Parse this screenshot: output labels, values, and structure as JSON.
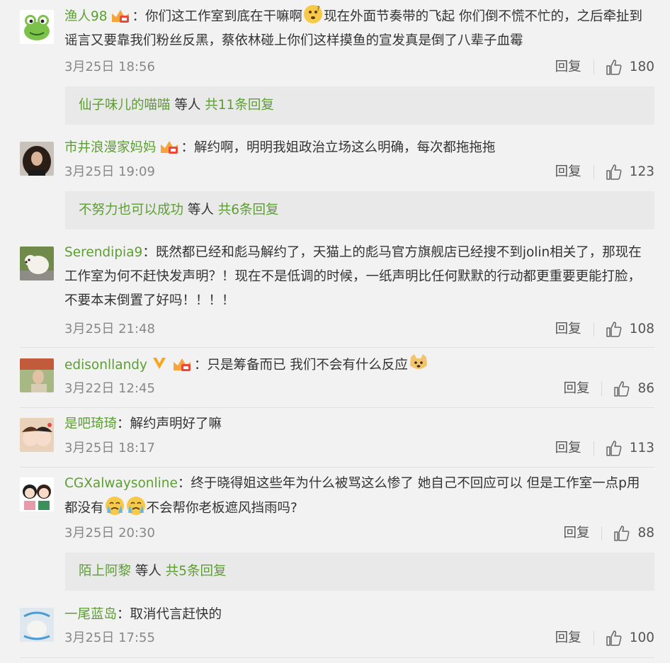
{
  "reply_label": "回复",
  "comments": [
    {
      "user": "渔人98",
      "text": "：你们这工作室到底在干嘛啊",
      "text2": "现在外面节奏带的飞起 你们倒不慌不忙的，之后牵扯到谣言又要靠我们粉丝反黑，蔡依林碰上你们这样摸鱼的宣发真是倒了八辈子血霉",
      "time": "3月25日 18:56",
      "likes": "180",
      "replies": {
        "names": "仙子味儿的喵喵",
        "mid": " 等人 ",
        "count": "共11条回复"
      }
    },
    {
      "user": "市井浪漫家妈妈",
      "text": "：解约啊，明明我姐政治立场这么明确，每次都拖拖拖",
      "time": "3月25日 19:09",
      "likes": "123",
      "replies": {
        "names": "不努力也可以成功",
        "mid": " 等人 ",
        "count": "共6条回复"
      }
    },
    {
      "user": "Serendipia9",
      "text": "：既然都已经和彪马解约了，天猫上的彪马官方旗舰店已经搜不到jolin相关了，那现在工作室为何不赶快发声明？！现在不是低调的时候，一纸声明比任何默默的行动都更重要更能打脸，不要本末倒置了好吗！！！！",
      "time": "3月25日 21:48",
      "likes": "108"
    },
    {
      "user": "edisonllandy",
      "text": "：只是筹备而已 我们不会有什么反应",
      "time": "3月22日 12:45",
      "likes": "86"
    },
    {
      "user": "是吧琦琦",
      "text": "：解约声明好了嘛",
      "time": "3月25日 18:17",
      "likes": "113"
    },
    {
      "user": "CGXalwaysonline",
      "text": "：终于晓得姐这些年为什么被骂这么惨了 她自己不回应可以 但是工作室一点p用都没有",
      "text2": "不会帮你老板遮风挡雨吗?",
      "time": "3月25日 20:30",
      "likes": "88",
      "replies": {
        "names": "陌上阿黎",
        "mid": " 等人 ",
        "count": "共5条回复"
      }
    },
    {
      "user": "一尾蓝岛",
      "text": "：取消代言赶快的",
      "time": "3月25日 17:55",
      "likes": "100"
    }
  ],
  "colors": {
    "username": "#5d9e33",
    "background": "#f2f2f2",
    "reply_box": "#e9e9e9"
  },
  "icons": [
    "frog-avatar",
    "crown-badge",
    "thinking-emoji",
    "v-verified-icon",
    "doge-emoji",
    "cry-emoji",
    "thumbs-up-icon"
  ]
}
